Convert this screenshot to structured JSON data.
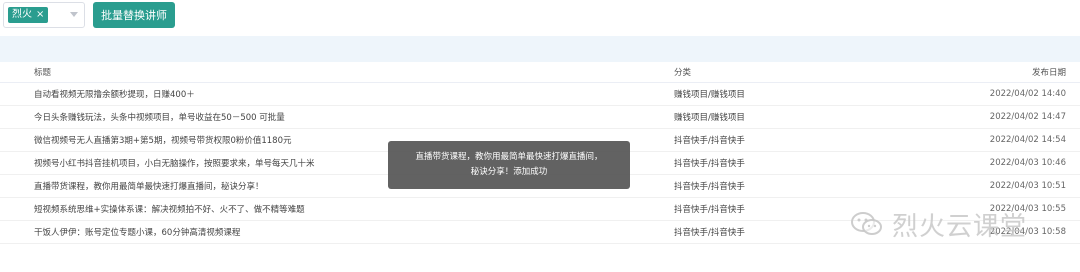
{
  "filter": {
    "selected_tag": "烈火",
    "tag_close": "×"
  },
  "toolbar": {
    "batch_replace_label": "批量替换讲师"
  },
  "table": {
    "headers": {
      "title": "标题",
      "category": "分类",
      "date": "发布日期"
    },
    "rows": [
      {
        "title": "自动看视频无限撸余额秒提现，日赚400＋",
        "category": "赚钱项目/赚钱项目",
        "date": "2022/04/02 14:40"
      },
      {
        "title": "今日头条赚钱玩法，头条中视频项目，单号收益在50－500 可批量",
        "category": "赚钱项目/赚钱项目",
        "date": "2022/04/02 14:47"
      },
      {
        "title": "微信视频号无人直播第3期+第5期，视频号带货权限0粉价值1180元",
        "category": "抖音快手/抖音快手",
        "date": "2022/04/02 14:54"
      },
      {
        "title": "视频号小红书抖音挂机项目，小白无脑操作，按照要求来，单号每天几十米",
        "category": "抖音快手/抖音快手",
        "date": "2022/04/03 10:46"
      },
      {
        "title": "直播带货课程，教你用最简单最快速打爆直播间，秘诀分享！",
        "category": "抖音快手/抖音快手",
        "date": "2022/04/03 10:51"
      },
      {
        "title": "短视频系统思维+实操体系课：解决视频拍不好、火不了、做不精等难题",
        "category": "抖音快手/抖音快手",
        "date": "2022/04/03 10:55"
      },
      {
        "title": "干饭人伊伊：账号定位专题小课，60分钟高清视频课程",
        "category": "抖音快手/抖音快手",
        "date": "2022/04/03 10:58"
      }
    ]
  },
  "toast": {
    "line1": "直播带货课程，教你用最简单最快速打爆直播间，",
    "line2": "秘诀分享！添加成功"
  },
  "watermark": {
    "text": "烈火云课堂",
    "icon": "wechat-icon"
  }
}
